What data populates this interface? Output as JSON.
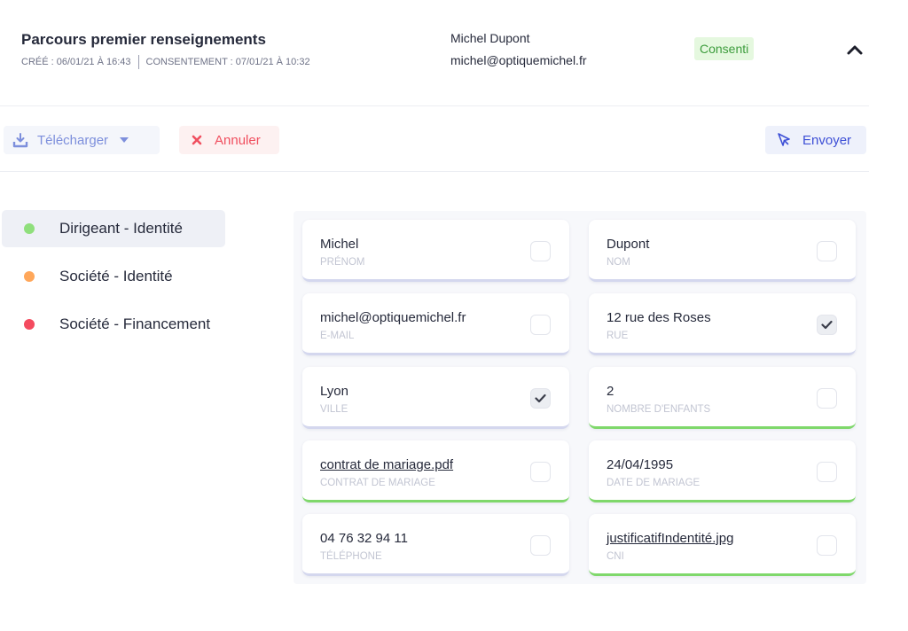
{
  "header": {
    "title": "Parcours premier renseignements",
    "created": "CRÉÉ : 06/01/21 À 16:43",
    "consent": "CONSENTEMENT : 07/01/21 À 10:32",
    "user_name": "Michel Dupont",
    "user_email": "michel@optiquemichel.fr",
    "status": "Consenti",
    "status_color": "#3c9c3c"
  },
  "toolbar": {
    "download_label": "Télécharger",
    "cancel_label": "Annuler",
    "send_label": "Envoyer"
  },
  "sidebar": {
    "items": [
      {
        "label": "Dirigeant - Identité",
        "color": "#8fdf7c"
      },
      {
        "label": "Société - Identité",
        "color": "#ffa75a"
      },
      {
        "label": "Société - Financement",
        "color": "#f44b5f"
      }
    ]
  },
  "fields": [
    {
      "value": "Michel",
      "label": "PRÉNOM",
      "checked": false,
      "link": false,
      "complete": false
    },
    {
      "value": "Dupont",
      "label": "NOM",
      "checked": false,
      "link": false,
      "complete": false
    },
    {
      "value": "michel@optiquemichel.fr",
      "label": "E-MAIL",
      "checked": false,
      "link": false,
      "complete": false
    },
    {
      "value": "12 rue des Roses",
      "label": "RUE",
      "checked": true,
      "link": false,
      "complete": false
    },
    {
      "value": "Lyon",
      "label": "VILLE",
      "checked": true,
      "link": false,
      "complete": false
    },
    {
      "value": "2",
      "label": "NOMBRE D'ENFANTS",
      "checked": false,
      "link": false,
      "complete": true
    },
    {
      "value": "contrat de mariage.pdf",
      "label": "CONTRAT DE MARIAGE",
      "checked": false,
      "link": true,
      "complete": true
    },
    {
      "value": "24/04/1995",
      "label": "DATE DE MARIAGE",
      "checked": false,
      "link": false,
      "complete": true
    },
    {
      "value": "04 76 32 94 11",
      "label": "TÉLÉPHONE",
      "checked": false,
      "link": false,
      "complete": false
    },
    {
      "value": "justificatifIndentité.jpg",
      "label": "CNI",
      "checked": false,
      "link": true,
      "complete": true
    }
  ],
  "icons": {
    "download": "download-icon",
    "caret": "caret-down-icon",
    "cancel": "close-icon",
    "send": "cursor-arrow-icon",
    "collapse": "chevron-up-icon",
    "check": "check-icon"
  }
}
